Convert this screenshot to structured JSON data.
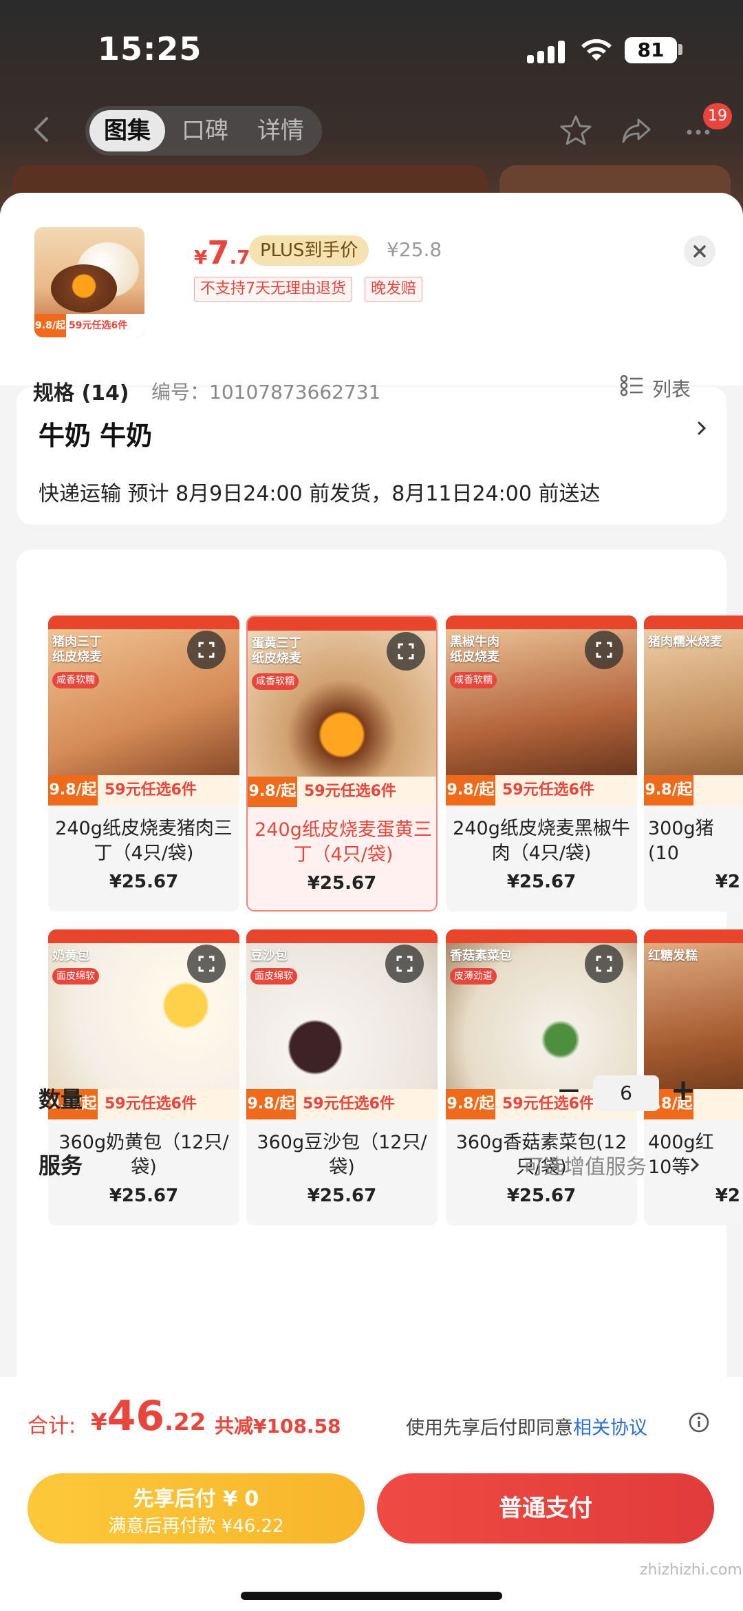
{
  "status_bar": {
    "time": "15:25",
    "battery": "81"
  },
  "nav": {
    "tabs": [
      "图集",
      "口碑",
      "详情"
    ],
    "active_tab": 0,
    "badge": "19"
  },
  "product": {
    "price_symbol": "¥",
    "price_int": "7",
    "price_dec": ".7",
    "plus_label": "PLUS到手价",
    "original_price": "¥25.8",
    "tags": [
      "不支持7天无理由退货",
      "晚发赔"
    ]
  },
  "thumb": {
    "promo_left": "9.8/起",
    "promo_right": "59元任选6件"
  },
  "address": {
    "name": "牛奶  牛奶",
    "delivery": "快递运输 预计 8月9日24:00 前发货，8月11日24:00 前送达"
  },
  "spec": {
    "title": "规格 (14)",
    "code": "编号：10107873662731",
    "list_label": "列表"
  },
  "skus": [
    {
      "name": "240g纸皮烧麦猪肉三丁（4只/袋)",
      "price": "¥25.67",
      "overlay": "猪肉三丁\n纸皮烧麦",
      "promo_left": "9.8/起",
      "promo_right": "59元任选6件",
      "selected": false
    },
    {
      "name": "240g纸皮烧麦蛋黄三丁（4只/袋)",
      "price": "¥25.67",
      "overlay": "蛋黄三丁\n纸皮烧麦",
      "promo_left": "9.8/起",
      "promo_right": "59元任选6件",
      "selected": true
    },
    {
      "name": "240g纸皮烧麦黑椒牛肉（4只/袋)",
      "price": "¥25.67",
      "overlay": "黑椒牛肉\n纸皮烧麦",
      "promo_left": "9.8/起",
      "promo_right": "59元任选6件",
      "selected": false
    },
    {
      "name": "300g猪\n(10",
      "price": "¥2",
      "overlay": "猪肉糯米烧麦",
      "promo_left": "9.8/起",
      "promo_right": "",
      "selected": false
    },
    {
      "name": "360g奶黄包（12只/袋)",
      "price": "¥25.67",
      "overlay": "奶黄包",
      "promo_left": "9.8/起",
      "promo_right": "59元任选6件",
      "selected": false
    },
    {
      "name": "360g豆沙包（12只/袋)",
      "price": "¥25.67",
      "overlay": "豆沙包",
      "promo_left": "9.8/起",
      "promo_right": "59元任选6件",
      "selected": false
    },
    {
      "name": "360g香菇素菜包(12只/袋)",
      "price": "¥25.67",
      "overlay": "香菇素菜包",
      "promo_left": "9.8/起",
      "promo_right": "59元任选6件",
      "selected": false
    },
    {
      "name": "400g红\n10等",
      "price": "¥2",
      "overlay": "红糖发糕",
      "promo_left": "9.8/起",
      "promo_right": "",
      "selected": false
    }
  ],
  "quantity": {
    "label": "数量",
    "value": "6",
    "minus": "−",
    "plus": "+"
  },
  "service": {
    "label": "服务",
    "value": "可选增值服务"
  },
  "footer": {
    "total_label": "合计:",
    "total_symbol": "¥",
    "total_int": "46",
    "total_dec": ".22",
    "total_save": "共减¥108.58",
    "agree_text": "使用先享后付即同意",
    "agree_link": "相关协议",
    "later_line1": "先享后付 ¥ 0",
    "later_line2": "满意后再付款 ¥46.22",
    "pay_label": "普通支付",
    "watermark": "zhizhizhi.com"
  },
  "colors": {
    "accent": "#e8453c",
    "later": "#f8b52a",
    "link": "#2f6fd6"
  }
}
